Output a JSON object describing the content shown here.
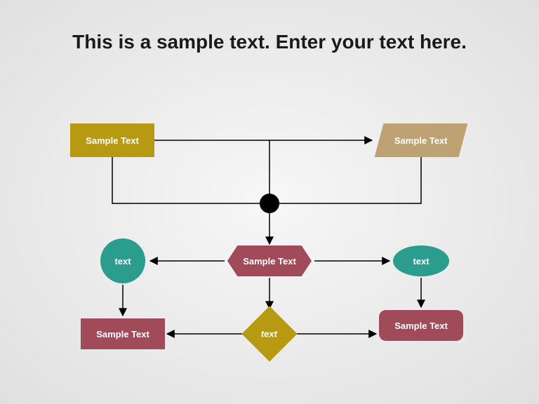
{
  "title": "This is a sample text. Enter your text here.",
  "nodes": {
    "topLeft": "Sample Text",
    "topRight": "Sample Text",
    "circle": "text",
    "ellipse": "text",
    "hexagon": "Sample Text",
    "bottomLeft": "Sample Text",
    "bottomRight": "Sample Text",
    "diamond": "text"
  },
  "colors": {
    "olive": "#b79a12",
    "tan": "#bfa273",
    "teal": "#2a9d8f",
    "maroon": "#a14a5a",
    "black": "#000000"
  }
}
